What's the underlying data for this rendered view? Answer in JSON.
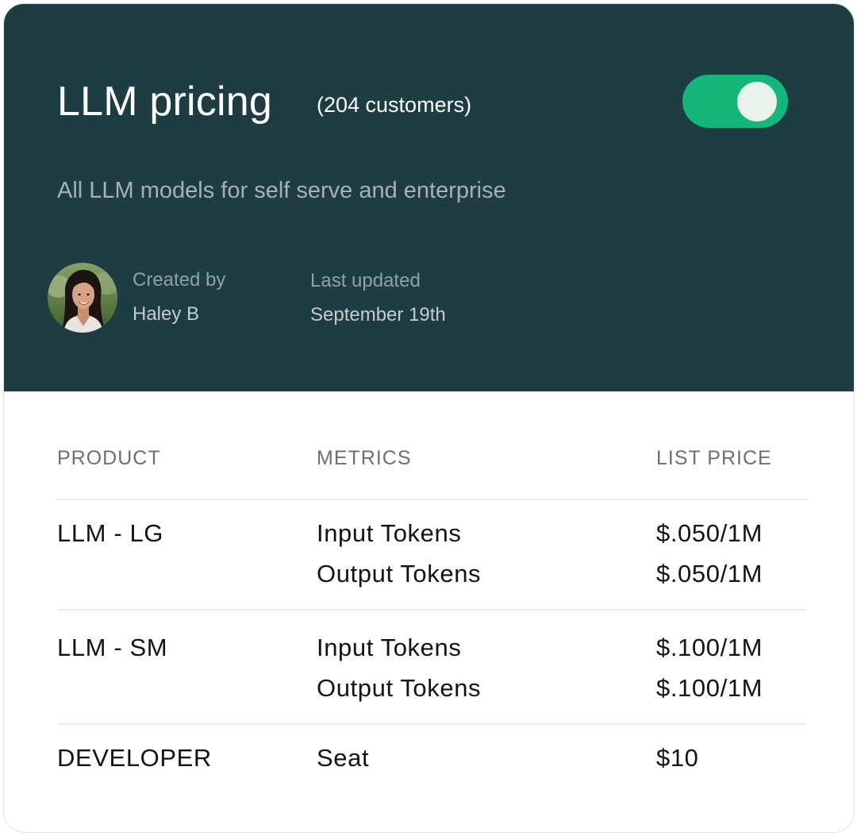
{
  "header": {
    "title": "LLM pricing",
    "customers": "(204 customers)",
    "toggle_on": true,
    "subtitle": "All LLM models for self serve and enterprise",
    "created_by_label": "Created by",
    "created_by_value": "Haley B",
    "last_updated_label": "Last updated",
    "last_updated_value": "September 19th"
  },
  "table": {
    "headers": [
      "PRODUCT",
      "METRICS",
      "LIST PRICE"
    ],
    "rows": [
      {
        "product": "LLM - LG",
        "metrics": [
          "Input Tokens",
          "Output Tokens"
        ],
        "prices": [
          "$.050/1M",
          "$.050/1M"
        ]
      },
      {
        "product": "LLM - SM",
        "metrics": [
          "Input Tokens",
          "Output Tokens"
        ],
        "prices": [
          "$.100/1M",
          "$.100/1M"
        ]
      },
      {
        "product": "DEVELOPER",
        "metrics": [
          "Seat"
        ],
        "prices": [
          "$10"
        ]
      }
    ]
  },
  "colors": {
    "header_bg": "#1e3d43",
    "toggle_on": "#14b679"
  }
}
